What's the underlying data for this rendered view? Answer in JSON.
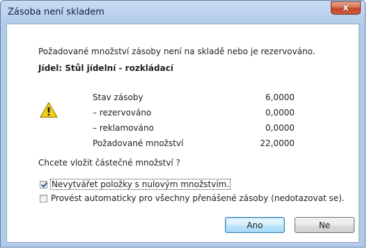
{
  "window": {
    "title": "Zásoba není skladem",
    "close_glyph": "x"
  },
  "message": "Požadované množství zásoby není na skladě nebo je rezervováno.",
  "item_label": "Jídel: Stůl jídelní - rozkládací",
  "icon": "warning-icon",
  "stock": [
    {
      "label": "Stav zásoby",
      "value": "6,0000"
    },
    {
      "label": "– rezervováno",
      "value": "0,0000"
    },
    {
      "label": "– reklamováno",
      "value": "0,0000"
    },
    {
      "label": "Požadované množství",
      "value": "22,0000"
    }
  ],
  "question": "Chcete vložit částečné množství ?",
  "options": [
    {
      "label": "Nevytvářet položky s nulovým množstvím.",
      "checked": true
    },
    {
      "label": "Provést automaticky pro všechny přenášené zásoby (nedotazovat se).",
      "checked": false
    }
  ],
  "buttons": {
    "yes": "Ano",
    "no": "Ne"
  },
  "colors": {
    "title_bar": "#bcd2ee",
    "close_button": "#c4452a",
    "warning_fill": "#f5d21a",
    "default_button_border": "#3c7fb1"
  }
}
